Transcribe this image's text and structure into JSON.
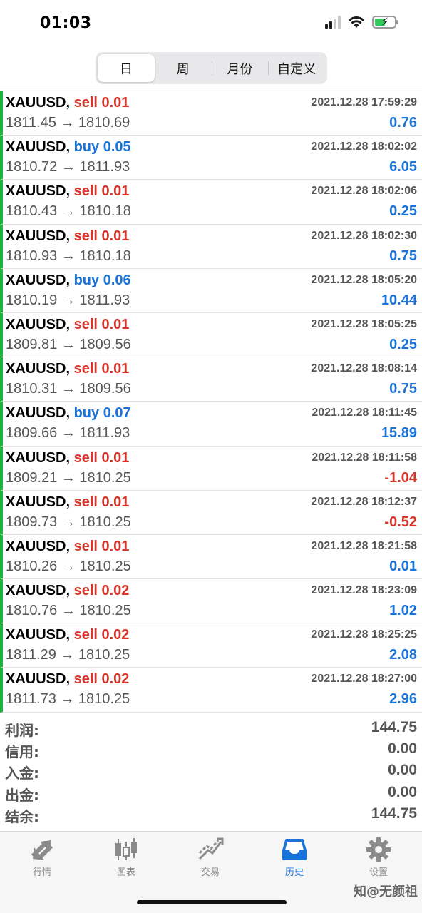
{
  "status_bar": {
    "time": "01:03"
  },
  "tabs": [
    "日",
    "周",
    "月份",
    "自定义"
  ],
  "trades": [
    {
      "symbol": "XAUUSD,",
      "side": "sell",
      "lot": "sell 0.01",
      "time": "2021.12.28 17:59:29",
      "prices": "1811.45 → 1810.69",
      "profit": "0.76",
      "negative": false
    },
    {
      "symbol": "XAUUSD,",
      "side": "buy",
      "lot": "buy 0.05",
      "time": "2021.12.28 18:02:02",
      "prices": "1810.72 → 1811.93",
      "profit": "6.05",
      "negative": false
    },
    {
      "symbol": "XAUUSD,",
      "side": "sell",
      "lot": "sell 0.01",
      "time": "2021.12.28 18:02:06",
      "prices": "1810.43 → 1810.18",
      "profit": "0.25",
      "negative": false
    },
    {
      "symbol": "XAUUSD,",
      "side": "sell",
      "lot": "sell 0.01",
      "time": "2021.12.28 18:02:30",
      "prices": "1810.93 → 1810.18",
      "profit": "0.75",
      "negative": false
    },
    {
      "symbol": "XAUUSD,",
      "side": "buy",
      "lot": "buy 0.06",
      "time": "2021.12.28 18:05:20",
      "prices": "1810.19 → 1811.93",
      "profit": "10.44",
      "negative": false
    },
    {
      "symbol": "XAUUSD,",
      "side": "sell",
      "lot": "sell 0.01",
      "time": "2021.12.28 18:05:25",
      "prices": "1809.81 → 1809.56",
      "profit": "0.25",
      "negative": false
    },
    {
      "symbol": "XAUUSD,",
      "side": "sell",
      "lot": "sell 0.01",
      "time": "2021.12.28 18:08:14",
      "prices": "1810.31 → 1809.56",
      "profit": "0.75",
      "negative": false
    },
    {
      "symbol": "XAUUSD,",
      "side": "buy",
      "lot": "buy 0.07",
      "time": "2021.12.28 18:11:45",
      "prices": "1809.66 → 1811.93",
      "profit": "15.89",
      "negative": false
    },
    {
      "symbol": "XAUUSD,",
      "side": "sell",
      "lot": "sell 0.01",
      "time": "2021.12.28 18:11:58",
      "prices": "1809.21 → 1810.25",
      "profit": "-1.04",
      "negative": true
    },
    {
      "symbol": "XAUUSD,",
      "side": "sell",
      "lot": "sell 0.01",
      "time": "2021.12.28 18:12:37",
      "prices": "1809.73 → 1810.25",
      "profit": "-0.52",
      "negative": true
    },
    {
      "symbol": "XAUUSD,",
      "side": "sell",
      "lot": "sell 0.01",
      "time": "2021.12.28 18:21:58",
      "prices": "1810.26 → 1810.25",
      "profit": "0.01",
      "negative": false
    },
    {
      "symbol": "XAUUSD,",
      "side": "sell",
      "lot": "sell 0.02",
      "time": "2021.12.28 18:23:09",
      "prices": "1810.76 → 1810.25",
      "profit": "1.02",
      "negative": false
    },
    {
      "symbol": "XAUUSD,",
      "side": "sell",
      "lot": "sell 0.02",
      "time": "2021.12.28 18:25:25",
      "prices": "1811.29 → 1810.25",
      "profit": "2.08",
      "negative": false
    },
    {
      "symbol": "XAUUSD,",
      "side": "sell",
      "lot": "sell 0.02",
      "time": "2021.12.28 18:27:00",
      "prices": "1811.73 → 1810.25",
      "profit": "2.96",
      "negative": false
    }
  ],
  "summary": [
    {
      "label": "利润:",
      "value": "144.75"
    },
    {
      "label": "信用:",
      "value": "0.00"
    },
    {
      "label": "入金:",
      "value": "0.00"
    },
    {
      "label": "出金:",
      "value": "0.00"
    },
    {
      "label": "结余:",
      "value": "144.75"
    }
  ],
  "tab_bar": [
    {
      "label": "行情",
      "icon": "quotes-icon",
      "active": false
    },
    {
      "label": "图表",
      "icon": "chart-icon",
      "active": false
    },
    {
      "label": "交易",
      "icon": "trade-icon",
      "active": false
    },
    {
      "label": "历史",
      "icon": "history-icon",
      "active": true
    },
    {
      "label": "设置",
      "icon": "settings-icon",
      "active": false
    }
  ],
  "watermark": "知@无颜祖",
  "colors": {
    "sell": "#d8352a",
    "buy": "#1a73d9",
    "accent": "#1a73d9",
    "row_marker": "#1fb23a"
  }
}
